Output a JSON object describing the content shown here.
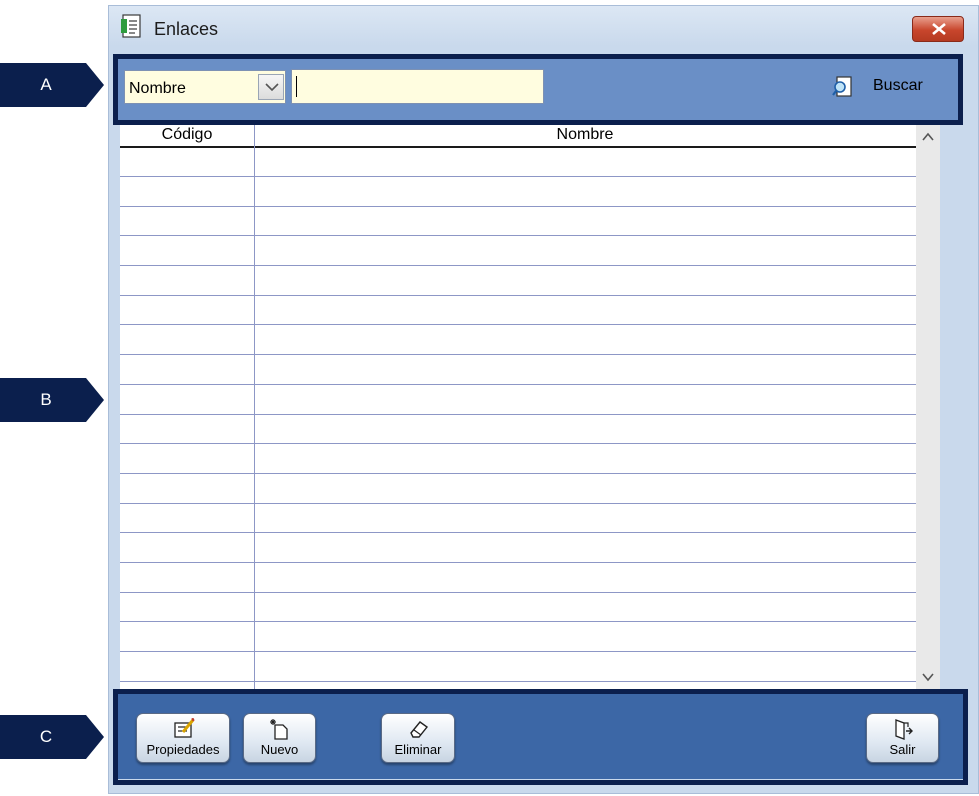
{
  "markers": {
    "a": "A",
    "b": "B",
    "c": "C"
  },
  "window": {
    "title": "Enlaces",
    "icon": "document-list-icon"
  },
  "search": {
    "field_selected": "Nombre",
    "input_value": "",
    "button_label": "Buscar",
    "button_icon": "search-document-icon"
  },
  "grid": {
    "columns": [
      "Código",
      "Nombre"
    ],
    "rows": []
  },
  "toolbar": {
    "propiedades_label": "Propiedades",
    "nuevo_label": "Nuevo",
    "eliminar_label": "Eliminar",
    "salir_label": "Salir"
  },
  "colors": {
    "marker": "#0b1f4d",
    "search_panel": "#6a8fc6",
    "toolbar": "#3c67a6",
    "close_button": "#c8462c"
  }
}
